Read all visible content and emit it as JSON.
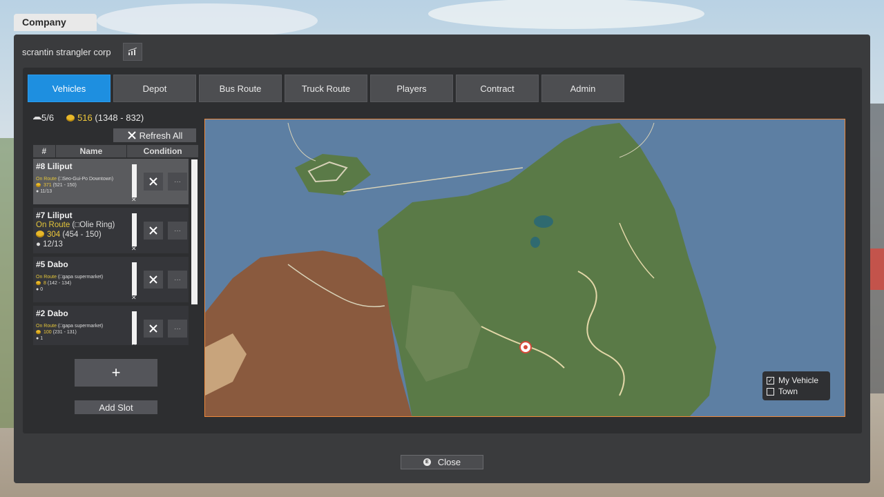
{
  "window": {
    "title": "Company",
    "company_name": "scrantin strangler corp"
  },
  "tabs": [
    {
      "label": "Vehicles",
      "active": true
    },
    {
      "label": "Depot"
    },
    {
      "label": "Bus Route"
    },
    {
      "label": "Truck Route"
    },
    {
      "label": "Players"
    },
    {
      "label": "Contract"
    },
    {
      "label": "Admin"
    }
  ],
  "summary": {
    "vehicle_count": "5/6",
    "money": "516",
    "money_detail": "(1348 - 832)"
  },
  "toolbar": {
    "refresh_label": "Refresh All"
  },
  "table": {
    "headers": [
      "#",
      "Name",
      "Condition"
    ]
  },
  "vehicles": [
    {
      "name": "#8 Liliput",
      "status": "On Route",
      "route": "Seo-Gui-Po Downtown",
      "money": "371",
      "money_detail": "(521 - 150)",
      "passengers": "11/13",
      "condition": 1.0
    },
    {
      "name": "#7 Liliput",
      "status": "On Route",
      "route": "Olie Ring",
      "money": "304",
      "money_detail": "(454 - 150)",
      "passengers": "12/13",
      "condition": 1.0
    },
    {
      "name": "#5 Dabo",
      "status": "On Route",
      "route": "gapa supermarket",
      "money": "8",
      "money_detail": "(142 - 134)",
      "passengers": "0",
      "condition": 1.0
    },
    {
      "name": "#2 Dabo",
      "status": "On Route",
      "route": "gapa supermarket",
      "money": "100",
      "money_detail": "(231 - 131)",
      "passengers": "1",
      "condition": 1.0
    }
  ],
  "actions": {
    "add_symbol": "+",
    "add_slot_label": "Add Slot"
  },
  "map_legend": [
    {
      "label": "My Vehicle",
      "checked": true
    },
    {
      "label": "Town",
      "checked": false
    }
  ],
  "footer": {
    "close_label": "Close",
    "close_key": "E"
  },
  "colors": {
    "accent": "#1e8fe0",
    "map_border": "#f08a3c",
    "status_text": "#e4c63a",
    "coin": "#e8b82a"
  },
  "icons": {
    "stats": "chart-icon",
    "repair": "wrench-icon",
    "more": "ellipsis-icon",
    "vehicle": "vehicle-icon",
    "coin": "coin-icon",
    "person": "person-icon",
    "bus": "bus-icon"
  }
}
